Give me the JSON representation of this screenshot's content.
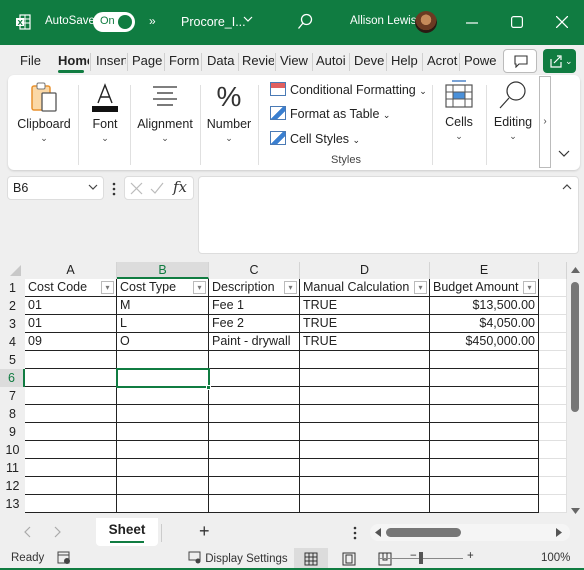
{
  "titlebar": {
    "app_icon": "excel-icon",
    "autosave_label": "AutoSave",
    "autosave_state": "On",
    "more_label": "»",
    "filename": "Procore_I...",
    "user_name": "Allison Lewis"
  },
  "tabs": [
    {
      "label": "File",
      "active": false
    },
    {
      "label": "Home",
      "active": true
    },
    {
      "label": "Insert",
      "active": false
    },
    {
      "label": "Page",
      "active": false
    },
    {
      "label": "Form",
      "active": false
    },
    {
      "label": "Data",
      "active": false
    },
    {
      "label": "Revie",
      "active": false
    },
    {
      "label": "View",
      "active": false
    },
    {
      "label": "Autoi",
      "active": false
    },
    {
      "label": "Devel",
      "active": false
    },
    {
      "label": "Help",
      "active": false
    },
    {
      "label": "Acrot",
      "active": false
    },
    {
      "label": "Powe",
      "active": false
    }
  ],
  "ribbon": {
    "clipboard": "Clipboard",
    "font": "Font",
    "alignment": "Alignment",
    "number": "Number",
    "conditional_formatting": "Conditional Formatting",
    "format_as_table": "Format as Table",
    "cell_styles": "Cell Styles",
    "styles_group": "Styles",
    "cells": "Cells",
    "editing": "Editing",
    "more": "›"
  },
  "formula_bar": {
    "name_box": "B6",
    "formula": ""
  },
  "sheet": {
    "columns": [
      "A",
      "B",
      "C",
      "D",
      "E"
    ],
    "selected_column": "B",
    "selected_row": "6",
    "row_numbers": [
      "1",
      "2",
      "3",
      "4",
      "5",
      "6",
      "7",
      "8",
      "9",
      "10",
      "11",
      "12",
      "13"
    ],
    "headers": [
      "Cost Code",
      "Cost Type",
      "Description",
      "Manual Calculation",
      "Budget Amount"
    ],
    "rows": [
      [
        "01",
        "M",
        "Fee 1",
        "TRUE",
        "$13,500.00"
      ],
      [
        "01",
        "L",
        "Fee 2",
        "TRUE",
        "$4,050.00"
      ],
      [
        "09",
        "O",
        "Paint - drywall",
        "TRUE",
        "$450,000.00"
      ]
    ]
  },
  "sheet_tabs": {
    "active": "Sheet",
    "add_label": "+"
  },
  "status": {
    "ready": "Ready",
    "display_settings": "Display Settings",
    "zoom": "100%",
    "zoom_minus": "−",
    "zoom_plus": "+"
  }
}
